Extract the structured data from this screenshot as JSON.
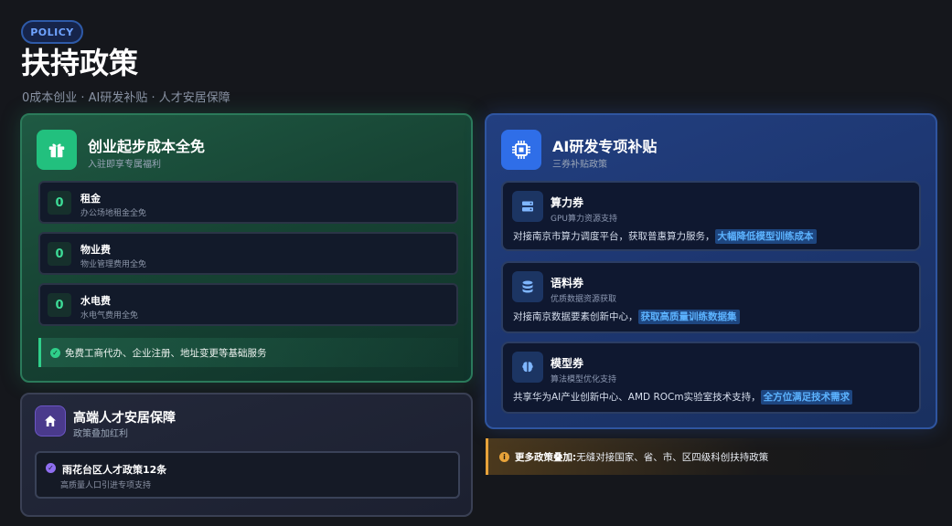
{
  "header": {
    "badge": "POLICY",
    "title": "扶持政策",
    "subtitle": "0成本创业 · AI研发补贴 · 人才安居保障"
  },
  "startup": {
    "title": "创业起步成本全免",
    "subtitle": "入驻即享专属福利",
    "items": [
      {
        "value": "0",
        "label": "租金",
        "desc": "办公场地租金全免"
      },
      {
        "value": "0",
        "label": "物业费",
        "desc": "物业管理费用全免"
      },
      {
        "value": "0",
        "label": "水电费",
        "desc": "水电气费用全免"
      }
    ],
    "note": "免费工商代办、企业注册、地址变更等基础服务"
  },
  "ai": {
    "title": "AI研发专项补贴",
    "subtitle": "三券补贴政策",
    "vouchers": [
      {
        "icon": "server-icon",
        "title": "算力券",
        "sub": "GPU算力资源支持",
        "desc": "对接南京市算力调度平台，获取普惠算力服务，",
        "highlight": "大幅降低模型训练成本"
      },
      {
        "icon": "database-icon",
        "title": "语料券",
        "sub": "优质数据资源获取",
        "desc": "对接南京数据要素创新中心，",
        "highlight": "获取高质量训练数据集"
      },
      {
        "icon": "brain-icon",
        "title": "模型券",
        "sub": "算法模型优化支持",
        "desc": "共享华为AI产业创新中心、AMD ROCm实验室技术支持，",
        "highlight": "全方位满足技术需求"
      }
    ]
  },
  "talent": {
    "title": "高端人才安居保障",
    "subtitle": "政策叠加红利",
    "policy_title": "雨花台区人才政策12条",
    "policy_sub": "高质量人口引进专项支持"
  },
  "more": {
    "label": "更多政策叠加:",
    "text": " 无缝对接国家、省、市、区四级科创扶持政策"
  },
  "colors": {
    "green_accent": "#2fcf8a",
    "blue_accent": "#2f6ee8",
    "purple_accent": "#8f6ef0",
    "orange_accent": "#e8a33a",
    "highlight": "#5cb3ff"
  }
}
